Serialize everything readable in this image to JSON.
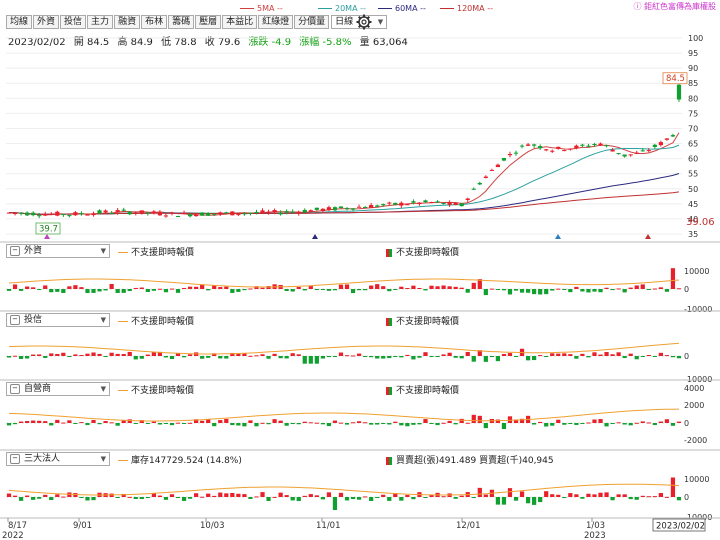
{
  "brand": {
    "text": "鉅紅色富傳為庫權股"
  },
  "ma_legend": [
    {
      "label": "5MA --",
      "color": "#d04040"
    },
    {
      "label": "20MA --",
      "color": "#2aa0a0"
    },
    {
      "label": "60MA --",
      "color": "#2a2a80"
    },
    {
      "label": "120MA --",
      "color": "#c03030"
    }
  ],
  "toolbar": {
    "tabs": [
      "均線",
      "外資",
      "投信",
      "主力",
      "融資",
      "布林",
      "籌碼",
      "壓層",
      "本益比",
      "紅綠燈",
      "分價量"
    ],
    "selected_tab": "均線",
    "period_select": "日線"
  },
  "quote": {
    "date": "2023/02/02",
    "open_label": "開",
    "open": "84.5",
    "high_label": "高",
    "high": "84.9",
    "low_label": "低",
    "low": "78.8",
    "close_label": "收",
    "close": "79.6",
    "change_label": "漲跌",
    "change": "-4.9",
    "pct_label": "漲幅",
    "pct": "-5.8%",
    "vol_label": "量",
    "vol": "63,064"
  },
  "price_axis": {
    "ticks": [
      "100",
      "95",
      "90",
      "85",
      "80",
      "75",
      "70",
      "65",
      "60",
      "55",
      "50",
      "45",
      "40",
      "35"
    ],
    "high_label": "84.5",
    "low_marker": "39.06",
    "min_label": "39.7"
  },
  "panels": [
    {
      "select": "外資",
      "legend_line": "不支援即時報價",
      "legend_bar": "不支援即時報價",
      "axis": [
        "10000",
        "0",
        "-10000"
      ]
    },
    {
      "select": "投信",
      "legend_line": "不支援即時報價",
      "legend_bar": "不支援即時報價",
      "axis": [
        "0",
        "-10000"
      ]
    },
    {
      "select": "自營商",
      "legend_line": "不支援即時報價",
      "legend_bar": "不支援即時報價",
      "axis": [
        "4000",
        "2000",
        "0",
        "-2000"
      ]
    },
    {
      "select": "三大法人",
      "legend_line": "庫存147729.524 (14.8%)",
      "legend_bar": "買賣超(張)491.489 買賣超(千)40,945",
      "axis": [
        "10000",
        "0",
        "-10000"
      ]
    }
  ],
  "x_axis": {
    "labels": [
      "8/17",
      "9/01",
      "10/03",
      "11/01",
      "12/01",
      "1/03",
      "2023/02/02"
    ],
    "years": [
      "2022",
      "2023"
    ]
  },
  "chart_data": {
    "type": "candlestick",
    "title": "",
    "date_range": [
      "2022/08/17",
      "2023/02/02"
    ],
    "ylim": [
      35,
      100
    ],
    "last_candle": {
      "date": "2023/02/02",
      "open": 84.5,
      "high": 84.9,
      "low": 78.8,
      "close": 79.6,
      "volume": 63064
    },
    "period_high": 84.5,
    "period_low": 39.06
  },
  "colors": {
    "up": "#e8202a",
    "down": "#10a030",
    "ma5": "#d04040",
    "ma20": "#2aa0a0",
    "ma60": "#2a2a80",
    "ma120": "#c03030",
    "line": "#f0a030"
  }
}
